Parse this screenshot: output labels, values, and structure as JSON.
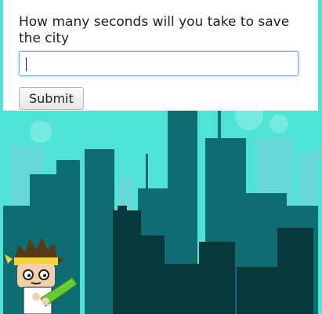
{
  "question": {
    "text": "How many seconds will you take to save the city"
  },
  "answer": {
    "value": "",
    "placeholder": ""
  },
  "submit": {
    "label": "Submit"
  },
  "colors": {
    "sky": "#4fe3d6",
    "far_buildings": "#66d8d8",
    "mid_buildings": "#0d6d72",
    "near_buildings": "#06383c",
    "ninja_band": "#f4d23a",
    "plant_green": "#66cc33"
  },
  "icons": {
    "sprout": "sprout-icon",
    "ninja": "ninja-character-icon"
  }
}
